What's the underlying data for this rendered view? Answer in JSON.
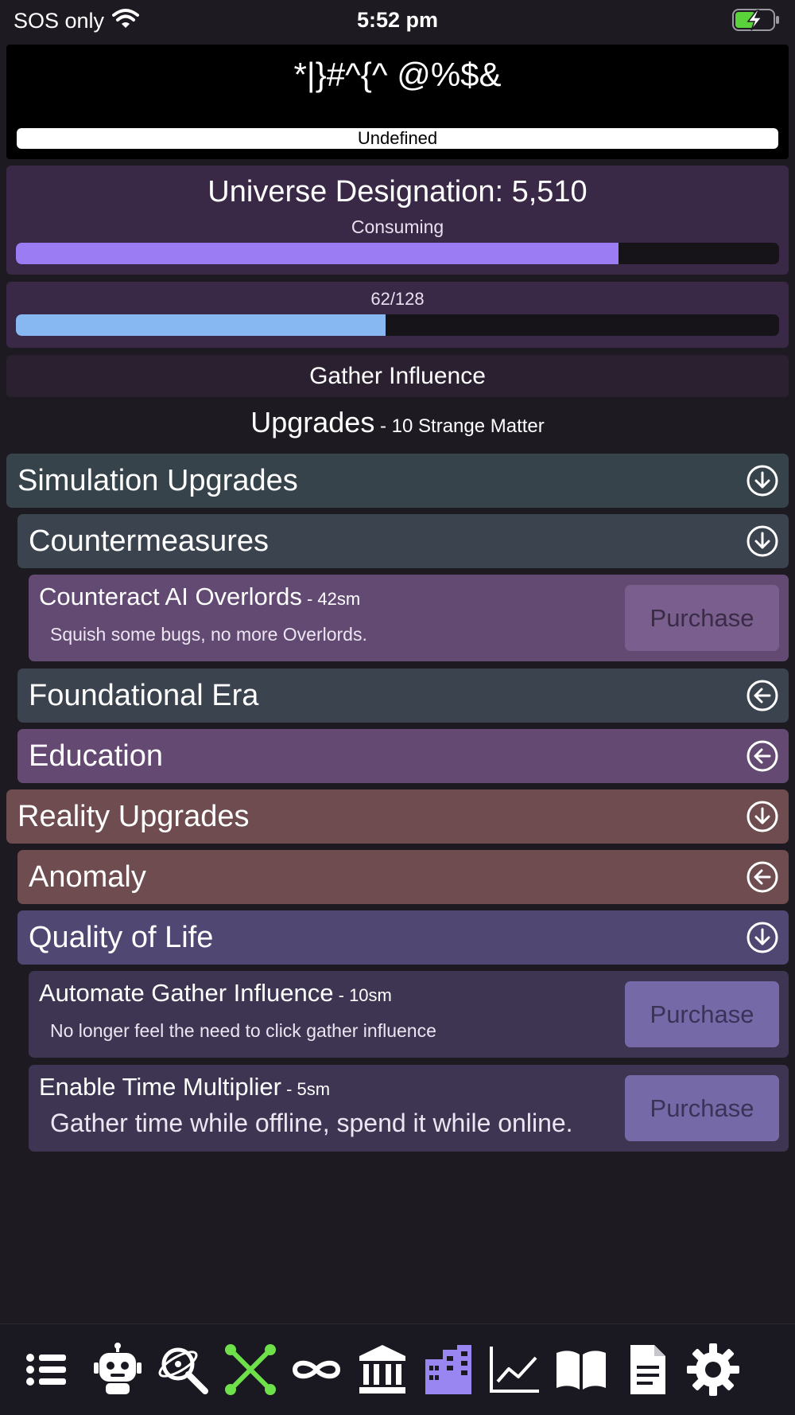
{
  "status_bar": {
    "carrier": "SOS only",
    "time": "5:52 pm",
    "battery": "charging"
  },
  "header": {
    "cipher_title": "*|}#^{^ @%$&",
    "undefined_label": "Undefined"
  },
  "universe": {
    "title": "Universe Designation: 5,510",
    "status": "Consuming",
    "progress": 0.79
  },
  "counter": {
    "text": "62/128",
    "progress": 0.484
  },
  "gather_button": "Gather Influence",
  "upgrades": {
    "title": "Upgrades",
    "cost_note": " - 10 Strange Matter"
  },
  "sections": {
    "simulation": {
      "label": "Simulation Upgrades",
      "icon": "arrow-down-circle-icon"
    },
    "countermeasures": {
      "label": "Countermeasures",
      "icon": "arrow-down-circle-icon"
    },
    "foundational": {
      "label": "Foundational Era",
      "icon": "arrow-left-circle-icon"
    },
    "education": {
      "label": "Education",
      "icon": "arrow-left-circle-icon"
    },
    "reality": {
      "label": "Reality Upgrades",
      "icon": "arrow-down-circle-icon"
    },
    "anomaly": {
      "label": "Anomaly",
      "icon": "arrow-left-circle-icon"
    },
    "qol": {
      "label": "Quality of Life",
      "icon": "arrow-down-circle-icon"
    }
  },
  "items": {
    "counteract": {
      "title": "Counteract AI Overlords",
      "cost": " - 42sm",
      "desc": "Squish some bugs, no more Overlords.",
      "button": "Purchase"
    },
    "automate": {
      "title": "Automate Gather Influence",
      "cost": " - 10sm",
      "desc": "No longer feel the need to click gather influence",
      "button": "Purchase"
    },
    "time_multiplier": {
      "title": "Enable Time Multiplier",
      "cost": " - 5sm",
      "desc": "Gather time while offline, spend it while online.",
      "button": "Purchase"
    }
  },
  "colors": {
    "accent_purple": "#9b7cf2",
    "accent_blue": "#88b8f2",
    "active_nav_green": "#6ee04a",
    "active_nav_purple": "#9a86f0"
  },
  "bottom_nav": [
    "list-icon",
    "robot-icon",
    "research-icon",
    "network-icon",
    "infinity-icon",
    "bank-icon",
    "city-icon",
    "chart-icon",
    "book-icon",
    "document-icon",
    "settings-icon"
  ]
}
